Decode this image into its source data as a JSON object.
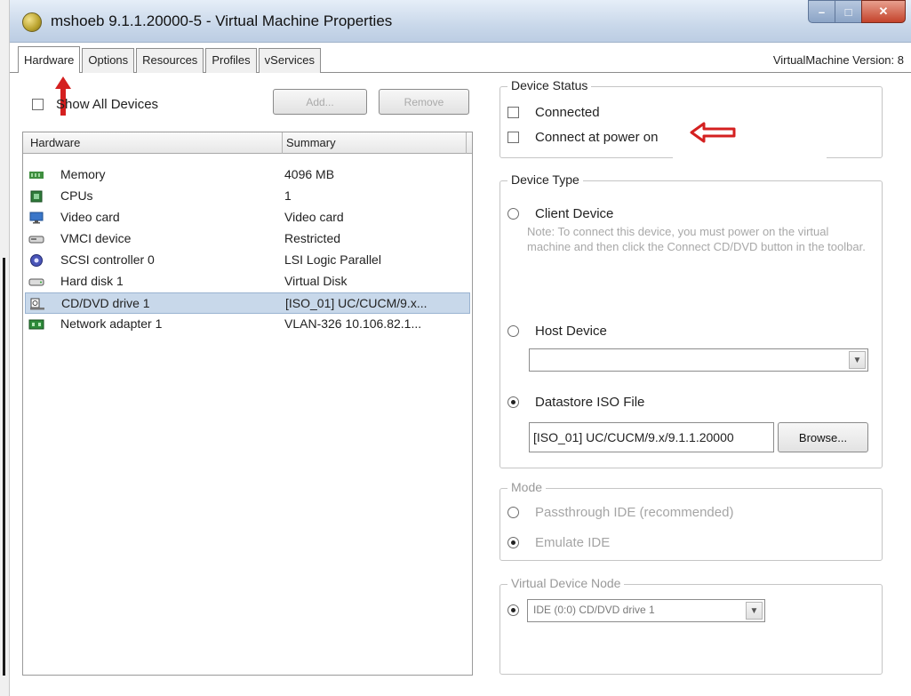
{
  "window": {
    "title": "mshoeb 9.1.1.20000-5 - Virtual Machine Properties",
    "controls": {
      "minimize": "–",
      "maximize": "□",
      "close": "✕"
    }
  },
  "tabs": [
    "Hardware",
    "Options",
    "Resources",
    "Profiles",
    "vServices"
  ],
  "vm_version": "VirtualMachine Version: 8",
  "hardware_panel": {
    "show_all_devices_label": "Show All Devices",
    "add_label": "Add...",
    "remove_label": "Remove",
    "col_hardware": "Hardware",
    "col_summary": "Summary",
    "rows": [
      {
        "icon": "memory-icon",
        "name": "Memory",
        "summary": "4096 MB"
      },
      {
        "icon": "cpu-icon",
        "name": "CPUs",
        "summary": "1"
      },
      {
        "icon": "monitor-icon",
        "name": "Video card",
        "summary": "Video card"
      },
      {
        "icon": "device-icon",
        "name": "VMCI device",
        "summary": "Restricted"
      },
      {
        "icon": "scsi-icon",
        "name": "SCSI controller 0",
        "summary": "LSI Logic Parallel"
      },
      {
        "icon": "disk-icon",
        "name": "Hard disk 1",
        "summary": "Virtual Disk"
      },
      {
        "icon": "cd-icon",
        "name": "CD/DVD drive 1",
        "summary": "[ISO_01] UC/CUCM/9.x...",
        "selected": true
      },
      {
        "icon": "network-icon",
        "name": "Network adapter 1",
        "summary": "VLAN-326 10.106.82.1..."
      }
    ]
  },
  "device_status": {
    "legend": "Device Status",
    "connected_label": "Connected",
    "connect_power_label": "Connect at power on"
  },
  "device_type": {
    "legend": "Device Type",
    "client_label": "Client Device",
    "client_note": "Note: To connect this device, you must power on the virtual machine and then click the Connect CD/DVD button in the toolbar.",
    "host_label": "Host Device",
    "host_select_value": "",
    "datastore_label": "Datastore ISO File",
    "datastore_value": "[ISO_01] UC/CUCM/9.x/9.1.1.20000",
    "browse_label": "Browse..."
  },
  "mode": {
    "legend": "Mode",
    "passthrough_label": "Passthrough IDE (recommended)",
    "emulate_label": "Emulate IDE"
  },
  "virtual_device_node": {
    "legend": "Virtual Device Node",
    "value": "IDE (0:0) CD/DVD drive 1"
  },
  "colors": {
    "selection": "#c8d8ea",
    "annotation_red": "#d42020"
  }
}
